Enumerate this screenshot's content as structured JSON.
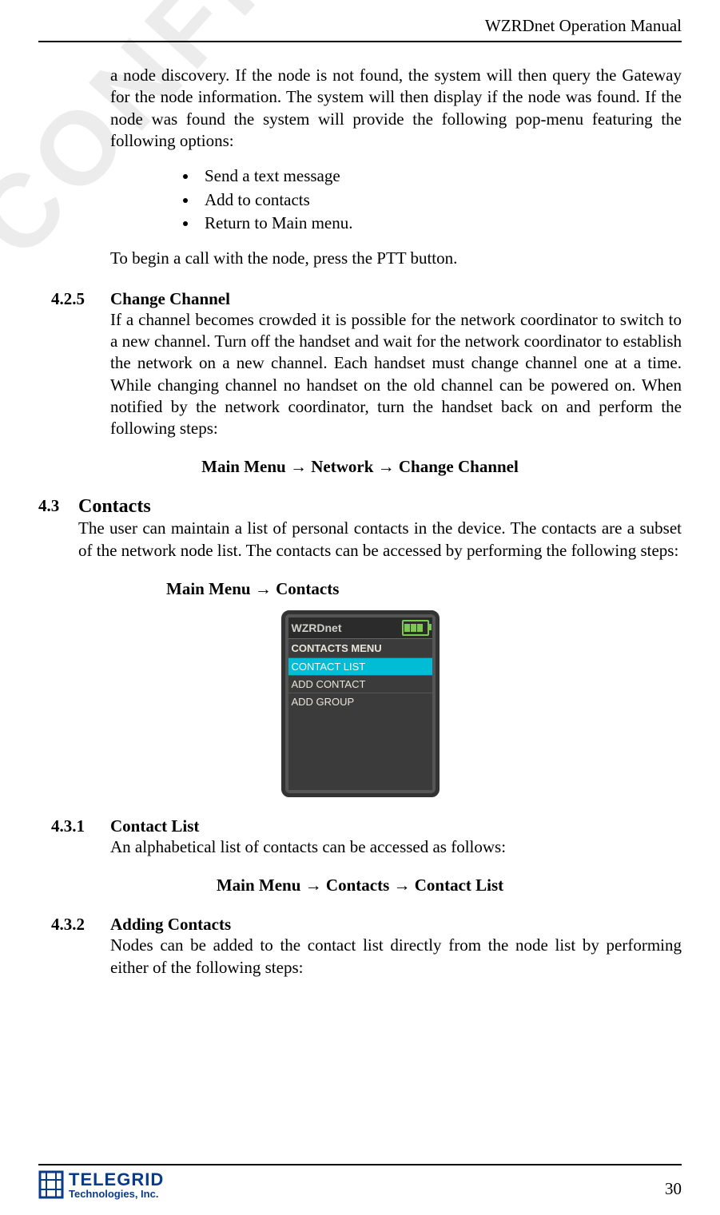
{
  "header": {
    "title": "WZRDnet Operation Manual"
  },
  "watermark": "CONFIDENTIAL",
  "intro": {
    "para1": "a node discovery.  If the node is not found, the system will then query the Gateway for the node information.  The system will then display if the node was found.  If the node was found the system will provide the following pop-menu featuring the following options:",
    "bullets": [
      "Send a text message",
      "Add to contacts",
      "Return to Main menu."
    ],
    "para2": "To begin a call with the node, press the PTT button."
  },
  "s425": {
    "num": "4.2.5",
    "title": "Change Channel",
    "body": "If a channel becomes crowded it is possible for the network coordinator to switch to a new channel.  Turn off the handset and wait for the network coordinator to establish the network on a new channel.  Each handset must change channel one at a time.  While changing channel no handset on the old channel can be powered on.  When notified by the network coordinator, turn the handset back on and perform the following steps:",
    "path": "Main Menu → Network → Change Channel"
  },
  "s43": {
    "num": "4.3",
    "title": "Contacts",
    "body": "The user can maintain a list of personal contacts in the device.  The contacts are a subset of the network node list.    The contacts can be accessed by performing the following steps:",
    "path": "Main Menu → Contacts"
  },
  "device": {
    "brand": "WZRDnet",
    "menu_title": "CONTACTS MENU",
    "items": [
      "CONTACT LIST",
      "ADD CONTACT",
      "ADD GROUP"
    ],
    "selected_index": 0
  },
  "s431": {
    "num": "4.3.1",
    "title": "Contact List",
    "body": "An alphabetical list of contacts can be accessed as follows:",
    "path": "Main Menu → Contacts → Contact List"
  },
  "s432": {
    "num": "4.3.2",
    "title": "Adding Contacts",
    "body": "Nodes can be added to the contact list directly from the node list by performing either of the following steps:"
  },
  "footer": {
    "logo_main": "TELEGRID",
    "logo_sub": "Technologies, Inc.",
    "page": "30"
  }
}
